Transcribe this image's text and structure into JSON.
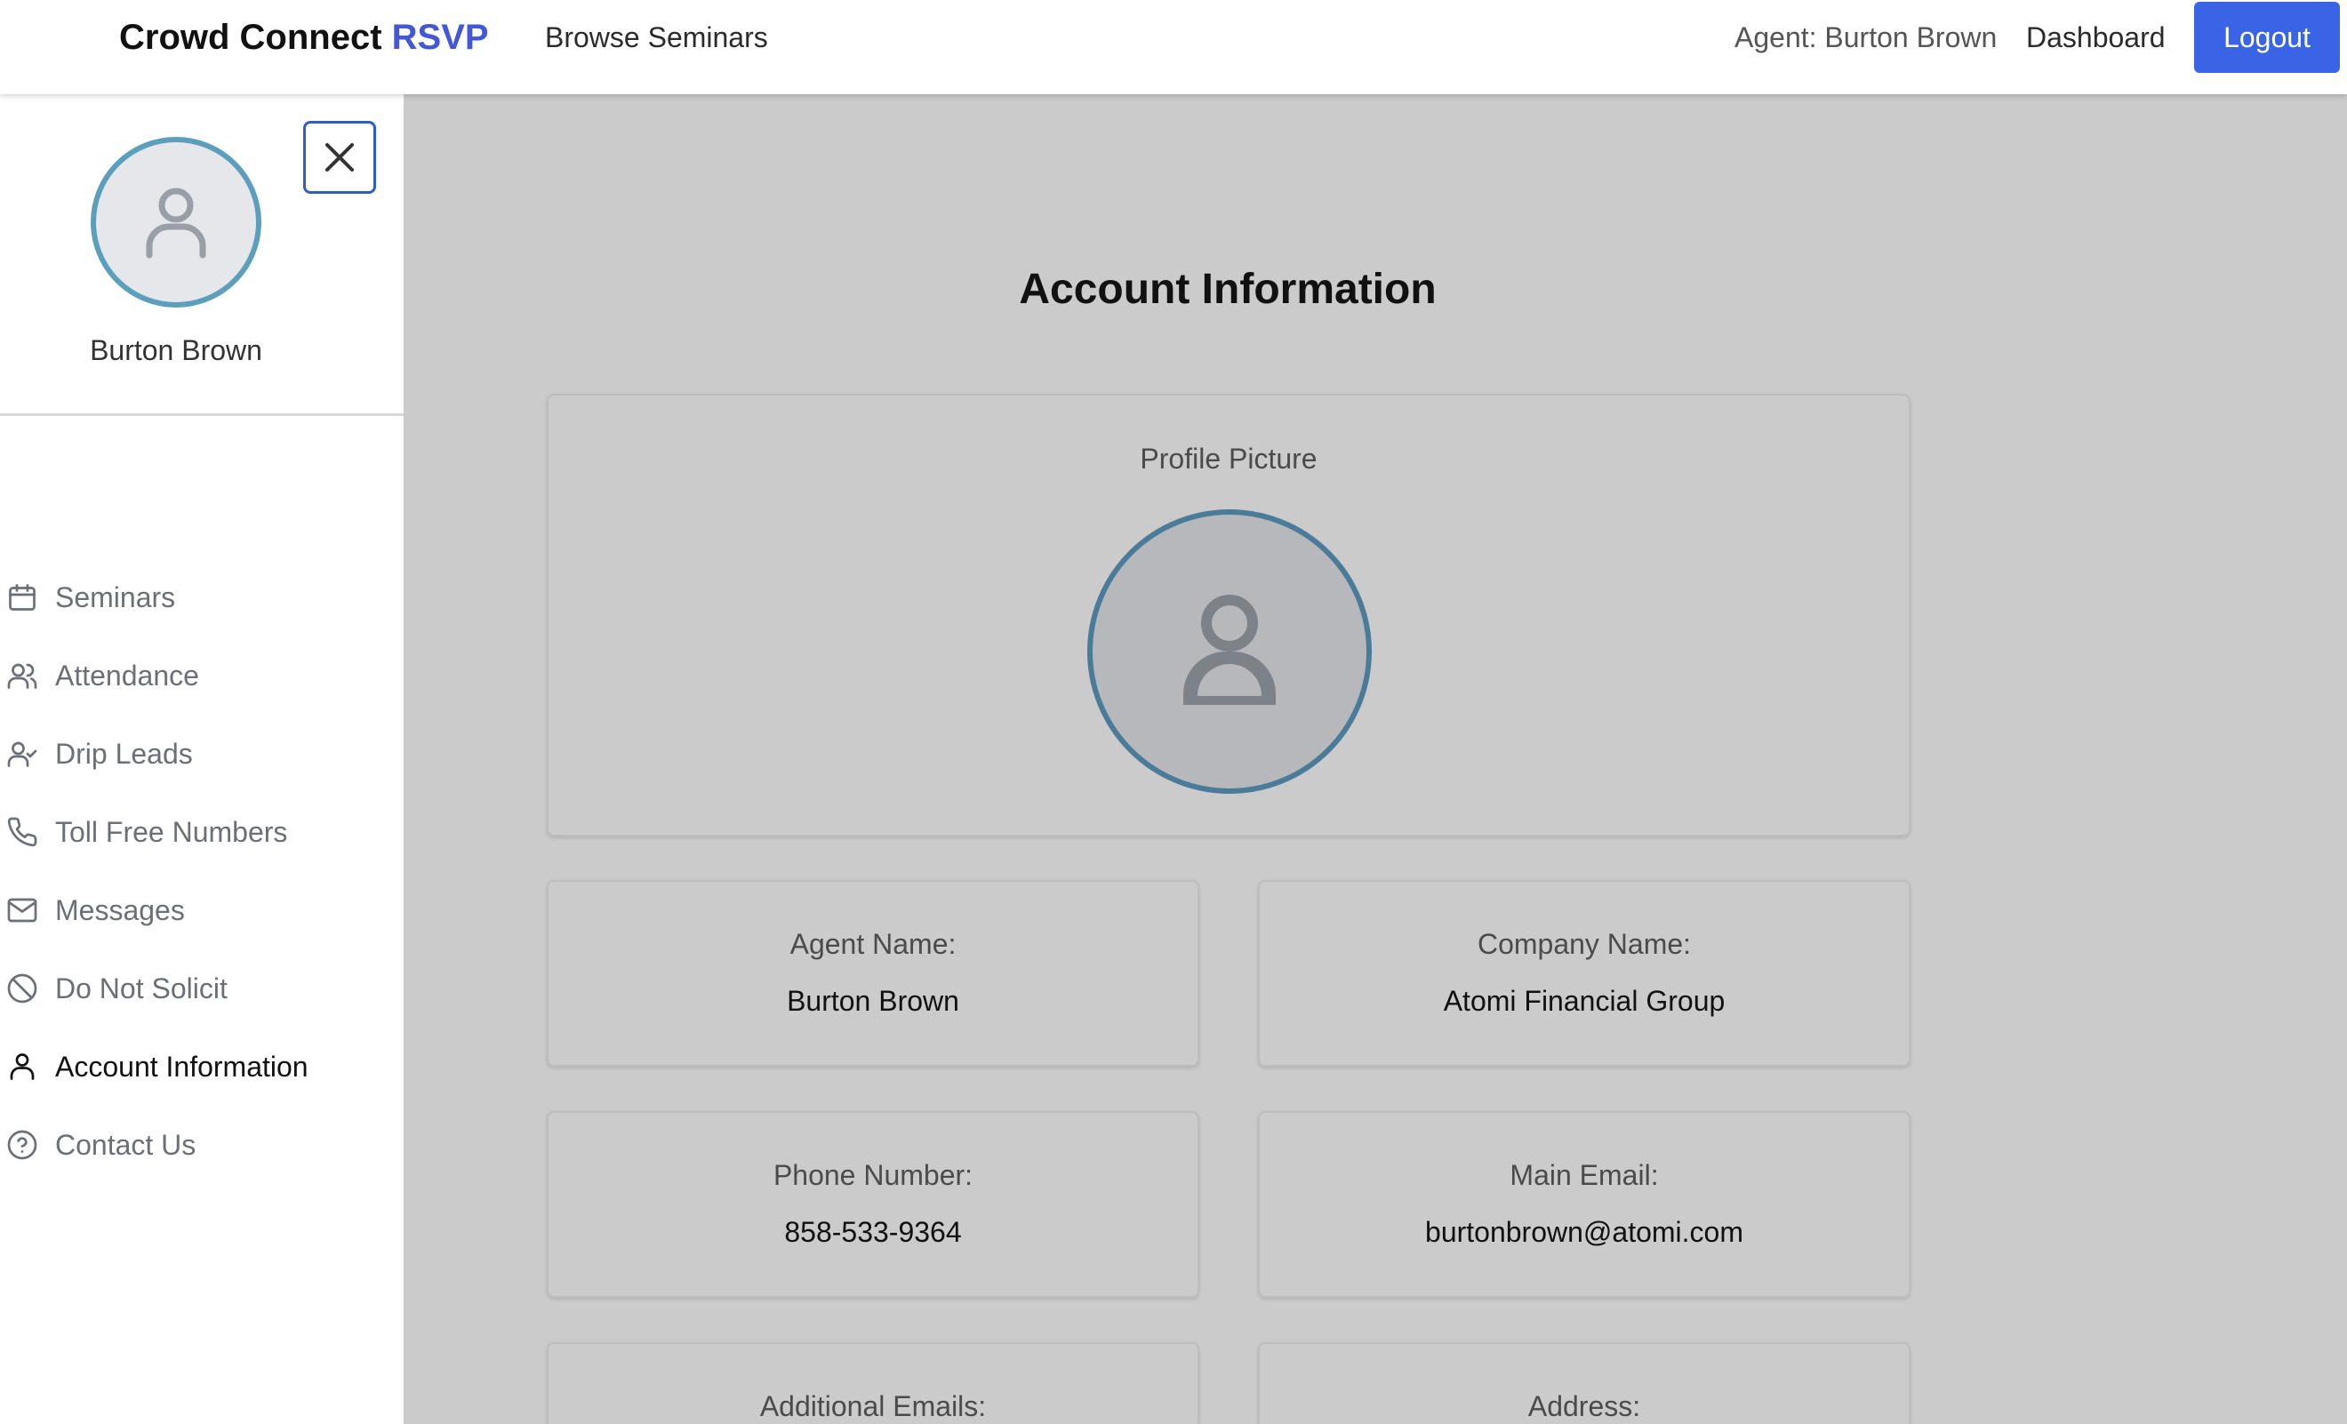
{
  "header": {
    "brand_main": "Crowd Connect",
    "brand_accent": "RSVP",
    "browse_label": "Browse Seminars",
    "agent_label": "Agent: Burton Brown",
    "dashboard_label": "Dashboard",
    "logout_label": "Logout"
  },
  "sidebar": {
    "user_name": "Burton Brown",
    "items": [
      {
        "label": "Seminars",
        "icon": "calendar-icon"
      },
      {
        "label": "Attendance",
        "icon": "users-icon"
      },
      {
        "label": "Drip Leads",
        "icon": "user-check-icon"
      },
      {
        "label": "Toll Free Numbers",
        "icon": "phone-icon"
      },
      {
        "label": "Messages",
        "icon": "mail-icon"
      },
      {
        "label": "Do Not Solicit",
        "icon": "ban-icon"
      },
      {
        "label": "Account Information",
        "icon": "user-icon",
        "active": true
      },
      {
        "label": "Contact Us",
        "icon": "help-circle-icon"
      }
    ]
  },
  "main": {
    "title": "Account Information",
    "profile_picture_label": "Profile Picture",
    "fields": [
      {
        "label": "Agent Name:",
        "value": "Burton Brown"
      },
      {
        "label": "Company Name:",
        "value": "Atomi Financial Group"
      },
      {
        "label": "Phone Number:",
        "value": "858-533-9364"
      },
      {
        "label": "Main Email:",
        "value": "burtonbrown@atomi.com"
      },
      {
        "label": "Additional Emails:",
        "value": ""
      },
      {
        "label": "Address:",
        "value": ""
      }
    ]
  },
  "colors": {
    "brand_accent": "#4457d6",
    "logout_button": "#3a64e6",
    "overlay_background": "#cbcbcb",
    "avatar_ring": "#5b9fbd"
  }
}
